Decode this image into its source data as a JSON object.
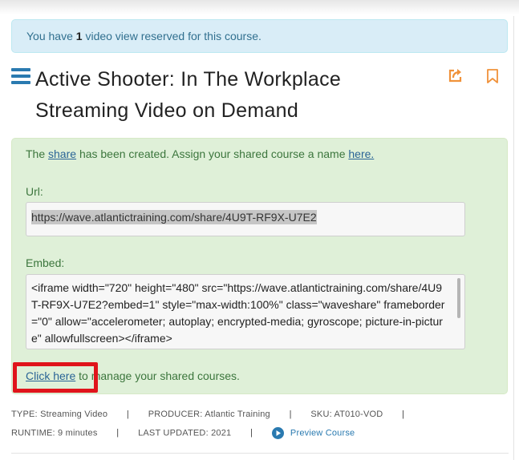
{
  "alert": {
    "prefix": "You have",
    "count": "1",
    "suffix": "video view reserved for this course."
  },
  "course": {
    "title_line1": "Active Shooter: In The Workplace",
    "title_line2": "Streaming Video on Demand"
  },
  "icons": {
    "menu": "hamburger-menu-icon",
    "share": "share-icon",
    "bookmark": "bookmark-icon",
    "play": "play-circle-icon"
  },
  "colors": {
    "accent_blue": "#2a7ab0",
    "accent_orange": "#f0923a",
    "success_bg": "#dff0d8",
    "info_bg": "#d9edf7",
    "highlight_red": "#e0141b"
  },
  "share_panel": {
    "msg_prefix": "The",
    "share_link": "share",
    "msg_middle": "has been created. Assign your shared course a name",
    "here_link": "here.",
    "url_label": "Url:",
    "url_value": "https://wave.atlantictraining.com/share/4U9T-RF9X-U7E2",
    "embed_label": "Embed:",
    "embed_value": "<iframe width=\"720\" height=\"480\" src=\"https://wave.atlantictraining.com/share/4U9T-RF9X-U7E2?embed=1\" style=\"max-width:100%\" class=\"waveshare\" frameborder=\"0\" allow=\"accelerometer; autoplay; encrypted-media; gyroscope; picture-in-picture\" allowfullscreen></iframe>",
    "click_here": "Click here",
    "manage_suffix": "to manage your shared courses."
  },
  "meta": {
    "type_label": "TYPE:",
    "type_value": "Streaming Video",
    "producer_label": "PRODUCER:",
    "producer_value": "Atlantic Training",
    "sku_label": "SKU:",
    "sku_value": "AT010-VOD",
    "runtime_label": "RUNTIME:",
    "runtime_value": "9 minutes",
    "updated_label": "LAST UPDATED:",
    "updated_value": "2021",
    "preview_label": "Preview Course",
    "separator": "|"
  }
}
